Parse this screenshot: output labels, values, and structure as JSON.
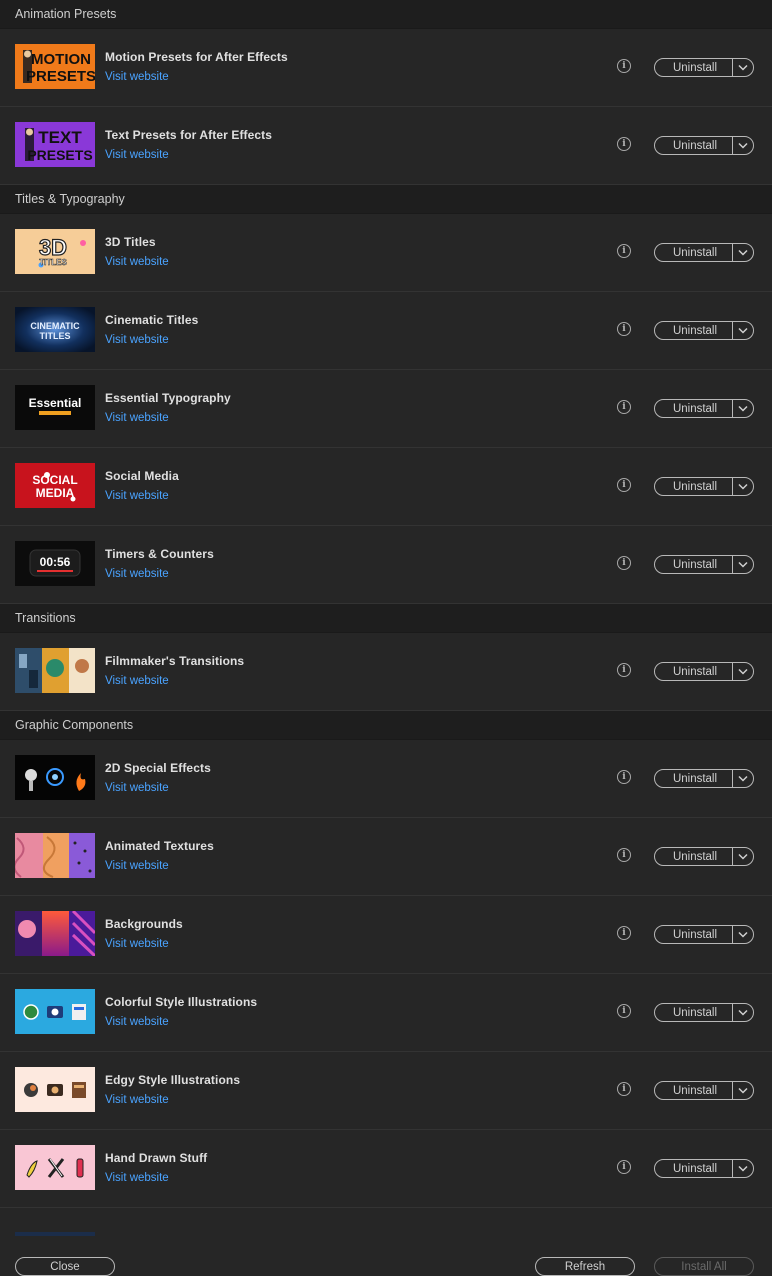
{
  "common": {
    "visit_label": "Visit website",
    "uninstall_label": "Uninstall",
    "info_glyph": "i"
  },
  "sections": [
    {
      "name": "Animation Presets",
      "items": [
        {
          "title": "Motion Presets for After Effects",
          "thumb": "motion-presets"
        },
        {
          "title": "Text Presets for After Effects",
          "thumb": "text-presets"
        }
      ]
    },
    {
      "name": "Titles & Typography",
      "items": [
        {
          "title": "3D Titles",
          "thumb": "3d-titles"
        },
        {
          "title": "Cinematic Titles",
          "thumb": "cinematic-titles"
        },
        {
          "title": "Essential Typography",
          "thumb": "essential-typography"
        },
        {
          "title": "Social Media",
          "thumb": "social-media"
        },
        {
          "title": "Timers & Counters",
          "thumb": "timers-counters"
        }
      ]
    },
    {
      "name": "Transitions",
      "items": [
        {
          "title": "Filmmaker's Transitions",
          "thumb": "filmmakers-transitions"
        }
      ]
    },
    {
      "name": "Graphic Components",
      "items": [
        {
          "title": "2D Special Effects",
          "thumb": "2d-special-effects"
        },
        {
          "title": "Animated Textures",
          "thumb": "animated-textures"
        },
        {
          "title": "Backgrounds",
          "thumb": "backgrounds"
        },
        {
          "title": "Colorful Style Illustrations",
          "thumb": "colorful-illustrations"
        },
        {
          "title": "Edgy Style Illustrations",
          "thumb": "edgy-illustrations"
        },
        {
          "title": "Hand Drawn Stuff",
          "thumb": "hand-drawn-stuff"
        }
      ]
    }
  ],
  "thumb_text": {
    "motion-presets": [
      "MOTION",
      "PRESETS"
    ],
    "text-presets": [
      "TEXT",
      "PRESETS"
    ],
    "3d-titles": [
      "3D",
      "TITLES"
    ],
    "cinematic-titles": [
      "CINEMATIC",
      "TITLES"
    ],
    "essential-typography": [
      "Essential",
      ""
    ],
    "social-media": [
      "SOCIAL",
      "MEDIA"
    ],
    "timers-counters": [
      "00:56",
      ""
    ]
  },
  "footer": {
    "close_label": "Close",
    "refresh_label": "Refresh",
    "install_all_label": "Install All"
  }
}
